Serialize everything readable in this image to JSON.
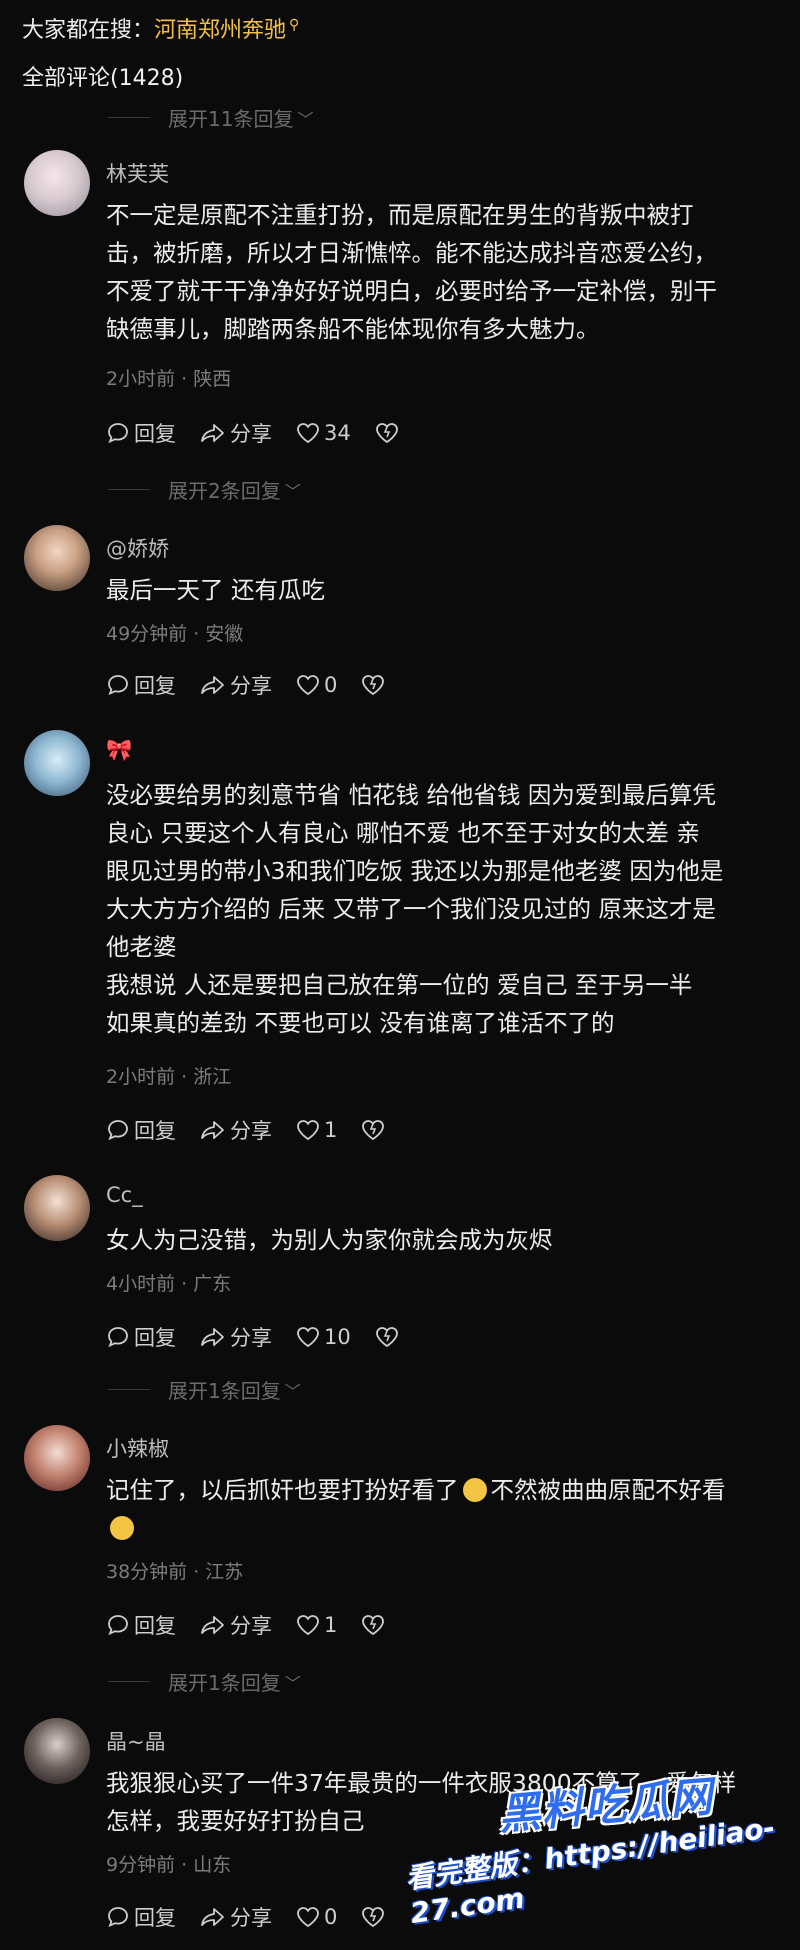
{
  "search": {
    "prefix": "大家都在搜：",
    "keyword": "河南郑州奔驰"
  },
  "comments_header": {
    "title": "全部评论(1428)"
  },
  "actions": {
    "reply": "回复",
    "share": "分享"
  },
  "expanders": [
    {
      "label": "展开11条回复"
    },
    {
      "label": "展开2条回复"
    },
    {
      "label": "展开1条回复"
    },
    {
      "label": "展开1条回复"
    }
  ],
  "comments": [
    {
      "name": "林芙芙",
      "lines": [
        "不一定是原配不注重打扮，而是原配在男生的背叛中被打",
        "击，被折磨，所以才日渐憔悴。能不能达成抖音恋爱公约，",
        "不爱了就干干净净好好说明白，必要时给予一定补偿，别干",
        "缺德事儿，脚踏两条船不能体现你有多大魅力。"
      ],
      "meta": "2小时前 · 陕西",
      "likes": "34"
    },
    {
      "name": "@娇娇",
      "lines": [
        "最后一天了 还有瓜吃"
      ],
      "meta": "49分钟前 · 安徽",
      "likes": "0"
    },
    {
      "name": "🎀",
      "lines": [
        "没必要给男的刻意节省 怕花钱 给他省钱 因为爱到最后算凭",
        "良心 只要这个人有良心 哪怕不爱 也不至于对女的太差 亲",
        "眼见过男的带小3和我们吃饭 我还以为那是他老婆 因为他是",
        "大大方方介绍的 后来 又带了一个我们没见过的 原来这才是",
        "他老婆",
        "我想说 人还是要把自己放在第一位的 爱自己 至于另一半",
        "如果真的差劲 不要也可以 没有谁离了谁活不了的"
      ],
      "meta": "2小时前 · 浙江",
      "likes": "1"
    },
    {
      "name": "Cc_",
      "lines": [
        "女人为己没错，为别人为家你就会成为灰烬"
      ],
      "meta": "4小时前 · 广东",
      "likes": "10"
    },
    {
      "name": "小辣椒",
      "line1a": "记住了，以后抓奸也要打扮好看了",
      "line1b": "不然被曲曲原配不好看",
      "meta": "38分钟前 · 江苏",
      "likes": "1"
    },
    {
      "name": "晶~晶",
      "lines": [
        "我狠狠心买了一件37年最贵的一件衣服3800不算了，爱怎样",
        "怎样，我要好好打扮自己"
      ],
      "meta": "9分钟前 · 山东",
      "likes": "0"
    }
  ],
  "watermark": {
    "site": "黑料吃瓜网",
    "url": "看完整版：https://heiliao-27.com"
  },
  "colors": {
    "background": "#0b0b0c",
    "keyword": "#f2c04a",
    "muted": "#7c7c80"
  }
}
